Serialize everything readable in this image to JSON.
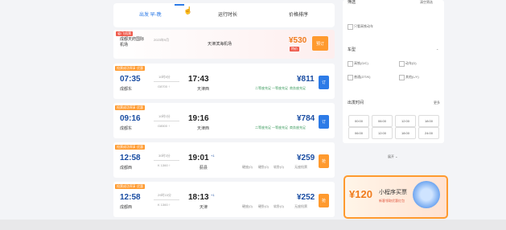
{
  "tabs": [
    "出发 早-晚",
    "运行时长",
    "价格排序"
  ],
  "promo": {
    "tag": "省/飞机票",
    "from": "成都天府国际机场",
    "date": "2023年9月",
    "to": "天津滨海机场",
    "price": "¥530",
    "badge": "特价",
    "button": "预订"
  },
  "trains": [
    {
      "tags": [
        "抢票成功率高",
        "优惠"
      ],
      "dep": "07:35",
      "dep_station": "成都东",
      "duration": "10时8分",
      "extra": "G8700 ↑",
      "arr": "17:43",
      "arr_station": "天津西",
      "price": "¥811",
      "seats": [
        "二等座充足",
        "一等座充足",
        "商务座充足"
      ],
      "button": "订",
      "btn_color": "blue"
    },
    {
      "tags": [
        "抢票成功率高",
        "优惠"
      ],
      "dep": "09:16",
      "dep_station": "成都东",
      "duration": "10时0分",
      "extra": "G8500 ↑",
      "arr": "19:16",
      "arr_station": "天津西",
      "price": "¥784",
      "seats": [
        "二等座充足",
        "一等座充足",
        "商务座充足"
      ],
      "button": "订",
      "btn_color": "blue"
    },
    {
      "tags": [
        "抢票成功率高",
        "优惠"
      ],
      "dep": "12:58",
      "dep_station": "成都西",
      "duration": "30时3分",
      "extra": "K 1360 ↑",
      "arr": "19:01",
      "arr_plus": "+1",
      "arr_station": "蓟县",
      "price": "¥259",
      "seats": [
        "硬座(0)",
        "硬卧(0)",
        "软卧(0)",
        "无座抢票"
      ],
      "button": "抢",
      "btn_color": "orange"
    },
    {
      "tags": [
        "抢票成功率高",
        "优惠"
      ],
      "dep": "12:58",
      "dep_station": "成都西",
      "duration": "29时15分",
      "extra": "K 1360 ↑",
      "arr": "18:13",
      "arr_plus": "+1",
      "arr_station": "天津",
      "price": "¥252",
      "seats": [
        "硬座(0)",
        "硬卧(0)",
        "软卧(0)",
        "无座抢票"
      ],
      "button": "抢",
      "btn_color": "orange"
    }
  ],
  "right": {
    "top_left": "筛选",
    "top_right": "清空筛选",
    "station_option": "只看高铁动车",
    "train_type_label": "车型",
    "train_types": [
      "高铁(G/C)",
      "动车(D)",
      "普通(Z/T/K)",
      "其他(L/Y)"
    ],
    "dep_time_label": "出发时间",
    "dep_time_more": "更多",
    "times_row1": [
      "00:00",
      "06:00",
      "12:00",
      "18:00"
    ],
    "times_row2": [
      "06:00",
      "12:00",
      "18:00",
      "24:00"
    ],
    "expand": "展开 ⌄"
  },
  "ad": {
    "amount": "¥120",
    "title": "小程序买票",
    "subtitle": "新客领取优惠红包"
  },
  "colors": {
    "accent": "#2d7be7",
    "orange": "#ff9a2e",
    "price_orange": "#f07c1d",
    "navy": "#1a4da2"
  }
}
